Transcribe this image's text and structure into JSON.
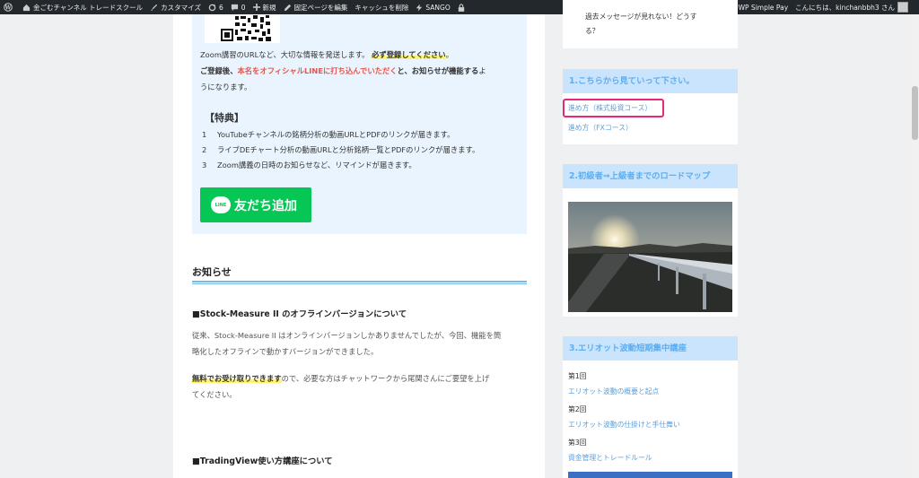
{
  "adminbar": {
    "site_name": "金ごむチャンネル トレードスクール",
    "customize": "カスタマイズ",
    "updates_count": "6",
    "comments_count": "0",
    "new": "新規",
    "edit_page": "固定ページを編集",
    "clear_cache": "キャッシュを削除",
    "sango": "SANGO",
    "wp_simple_pay": "WP Simple Pay",
    "greeting": "こんにちは、kinchanbbh3 さん"
  },
  "promo": {
    "line1_a": "Zoom講習のURLなど、大切な情報を発送します。",
    "line1_b": "必ず登録してください",
    "line1_c": "。",
    "line2_a": "ご登録後、",
    "line2_b": "本名をオフィシャルLINEに打ち込んでいただく",
    "line2_c": "と、お知らせが機能する",
    "line2_d": "よ",
    "line3": "うになります。",
    "tokuten_title": "【特典】",
    "tokuten": [
      {
        "num": "1",
        "text": "YouTubeチャンネルの銘柄分析の動画URLとPDFのリンクが届きます。"
      },
      {
        "num": "2",
        "text": "ライブDEチャート分析の動画URLと分析銘柄一覧とPDFのリンクが届きます。"
      },
      {
        "num": "3",
        "text": "Zoom講義の日時のお知らせなど、リマインドが届きます。"
      }
    ],
    "line_logo": "LINE",
    "line_button": "友だち追加"
  },
  "oshirase": {
    "title": "お知らせ",
    "article1_title": "■Stock-Measure II のオフラインバージョンについて",
    "article1_p1_l1": "従来、Stock-Measure II はオンラインバージョンしかありませんでしたが、今回、機能を簡",
    "article1_p1_l2": "略化したオフラインで動かすバージョンができました。",
    "article1_p2_mark": "無料でお受け取りできます",
    "article1_p2_rest": "ので、必要な方はチャットワークから尾関さんにご要望を上げ",
    "article1_p2_l2": "てください。",
    "article2_title": "■TradingView使い方講座について"
  },
  "sidebar": {
    "top_text_l1": "過去メッセージが見れない！どうす",
    "top_text_l2": "る？",
    "widget1_title": "1.こちらから見ていって下さい。",
    "widget1_link1": "進め方（株式投資コース）",
    "widget1_link2": "進め方（FXコース）",
    "widget2_title": "2.初級者⇒上級者までのロードマップ",
    "widget3_title": "3.エリオット波動短期集中講座",
    "lesson1_label": "第1回",
    "lesson1_link": "エリオット波動の概要と起点",
    "lesson2_label": "第2回",
    "lesson2_link": "エリオット波動の仕掛けと手仕舞い",
    "lesson3_label": "第3回",
    "lesson3_link": "資金管理とトレードルール"
  },
  "colors": {
    "adminbar_bg": "#23282d",
    "accent_blue": "#5eaef0",
    "line_green": "#06c755",
    "highlight_pink": "#e8277a",
    "promo_bg": "#e9f4ff"
  }
}
